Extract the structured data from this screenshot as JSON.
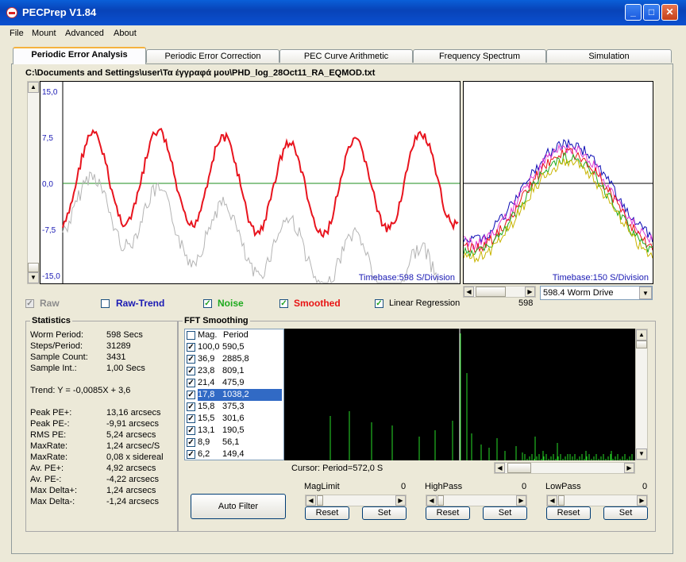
{
  "window": {
    "title": "PECPrep V1.84"
  },
  "menu": [
    "File",
    "Mount",
    "Advanced",
    "About"
  ],
  "tabs": [
    "Periodic Error Analysis",
    "Periodic Error Correction",
    "PEC Curve Arithmetic",
    "Frequency Spectrum",
    "Simulation"
  ],
  "file_path": "C:\\Documents and Settings\\user\\Τα έγγραφά μου\\PHD_log_28Oct11_RA_EQMOD.txt",
  "main_chart": {
    "y_ticks": [
      "15,0",
      "7,5",
      "0,0",
      "-7,5",
      "-15,0"
    ],
    "timebase": "Timebase:598 S/Division",
    "colors": {
      "smoothed": "#e8141e",
      "raw": "#b4b4b4",
      "zero": "#1e8c1e",
      "ticks": "#1a1ab4"
    }
  },
  "worm_chart": {
    "timebase": "Timebase:150 S/Division",
    "series_colors": [
      "#0a0ab4",
      "#e03cd0",
      "#e81414",
      "#1eaa1e",
      "#c8b400"
    ]
  },
  "worm_scroll_value": "598",
  "worm_select": "598.4 Worm Drive",
  "toggles": {
    "raw": {
      "label": "Raw",
      "checked": true,
      "color": "#8c8c8c"
    },
    "raw_trend": {
      "label": "Raw-Trend",
      "checked": false,
      "color": "#1a1ab4"
    },
    "noise": {
      "label": "Noise",
      "checked": true,
      "color": "#1eaa1e"
    },
    "smoothed": {
      "label": "Smoothed",
      "checked": true,
      "color": "#e81414"
    },
    "linear_regression": {
      "label": "Linear Regression",
      "checked": true
    }
  },
  "statistics": {
    "title": "Statistics",
    "rows1": [
      [
        "Worm Period:",
        "598 Secs"
      ],
      [
        "Steps/Period:",
        "31289"
      ],
      [
        "Sample Count:",
        "3431"
      ],
      [
        "Sample Int.:",
        "1,00 Secs"
      ]
    ],
    "trend": "Trend: Y = -0,0085X + 3,6",
    "rows2": [
      [
        "Peak PE+:",
        "13,16 arcsecs"
      ],
      [
        "Peak PE-:",
        "-9,91 arcsecs"
      ],
      [
        "RMS PE:",
        "5,24 arcsecs"
      ],
      [
        "MaxRate:",
        "1,24 arcsec/S"
      ],
      [
        "MaxRate:",
        "0,08 x sidereal"
      ],
      [
        "Av. PE+:",
        "4,92 arcsecs"
      ],
      [
        "Av. PE-:",
        "-4,22 arcsecs"
      ],
      [
        "Max Delta+:",
        "1,24 arcsecs"
      ],
      [
        "Max Delta-:",
        "-1,24 arcsecs"
      ]
    ]
  },
  "fft": {
    "title": "FFT Smoothing",
    "header": {
      "mag": "Mag.",
      "period": "Period"
    },
    "rows": [
      {
        "mag": "100,0",
        "period": "590,5",
        "checked": true
      },
      {
        "mag": "36,9",
        "period": "2885,8",
        "checked": true
      },
      {
        "mag": "23,8",
        "period": "809,1",
        "checked": true
      },
      {
        "mag": "21,4",
        "period": "475,9",
        "checked": true
      },
      {
        "mag": "17,8",
        "period": "1038,2",
        "checked": true,
        "selected": true
      },
      {
        "mag": "15,8",
        "period": "375,3",
        "checked": true
      },
      {
        "mag": "15,5",
        "period": "301,6",
        "checked": true
      },
      {
        "mag": "13,1",
        "period": "190,5",
        "checked": true
      },
      {
        "mag": "8,9",
        "period": "56,1",
        "checked": true
      },
      {
        "mag": "6,2",
        "period": "149,4",
        "checked": true
      }
    ],
    "cursor": "Cursor: Period=572,0 S",
    "spectrum_color": "#28dc28"
  },
  "filters": {
    "auto_filter": "Auto Filter",
    "maglimit": {
      "label": "MagLimit",
      "value": "0"
    },
    "highpass": {
      "label": "HighPass",
      "value": "0"
    },
    "lowpass": {
      "label": "LowPass",
      "value": "0"
    },
    "reset": "Reset",
    "set": "Set"
  }
}
